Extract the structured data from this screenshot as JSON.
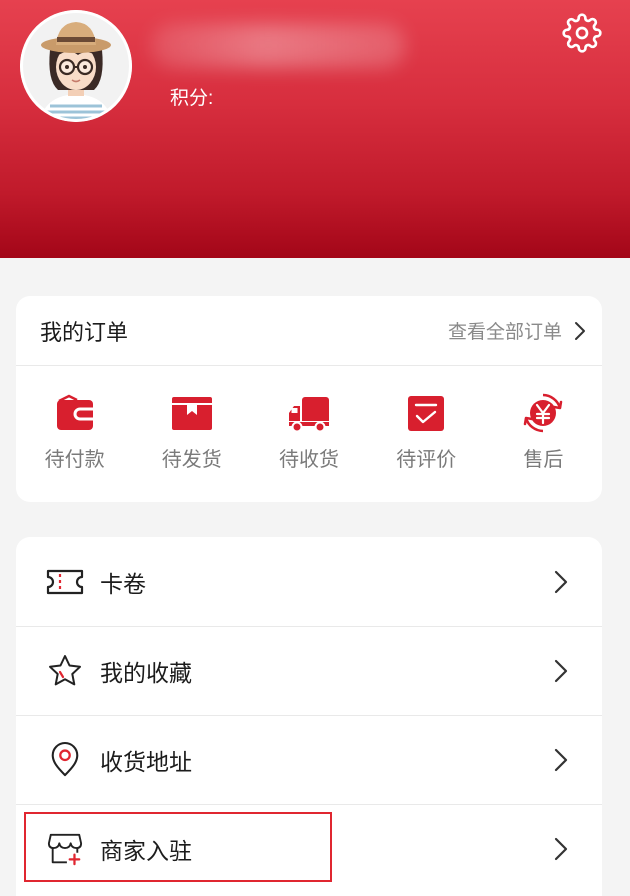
{
  "profile": {
    "points_label": "积分:",
    "avatar_icon": "cartoon-avatar"
  },
  "header": {
    "settings_icon": "gear-icon"
  },
  "orders": {
    "title": "我的订单",
    "view_all_label": "查看全部订单",
    "statuses": [
      {
        "label": "待付款",
        "icon": "wallet-icon"
      },
      {
        "label": "待发货",
        "icon": "package-icon"
      },
      {
        "label": "待收货",
        "icon": "truck-icon"
      },
      {
        "label": "待评价",
        "icon": "review-icon"
      },
      {
        "label": "售后",
        "icon": "refund-icon"
      }
    ]
  },
  "menu": {
    "items": [
      {
        "label": "卡卷",
        "icon": "ticket-icon"
      },
      {
        "label": "我的收藏",
        "icon": "star-icon"
      },
      {
        "label": "收货地址",
        "icon": "location-pin-icon"
      },
      {
        "label": "商家入驻",
        "icon": "store-icon",
        "highlighted": true
      }
    ]
  },
  "colors": {
    "header_top": "#e6414f",
    "header_bottom": "#a30618",
    "accent": "#d81f2e",
    "highlight": "#e02630",
    "background": "#f4f4f4"
  }
}
